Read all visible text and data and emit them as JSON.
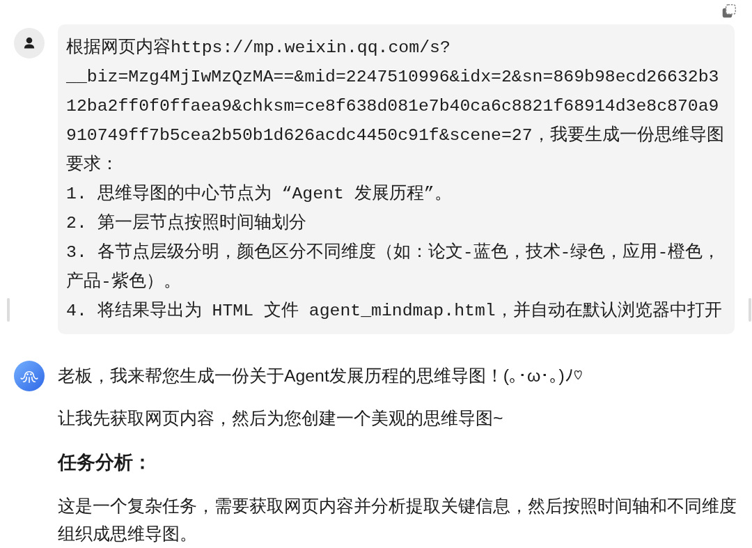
{
  "user_message": {
    "paragraphs": [
      "根据网页内容https://mp.weixin.qq.com/s?__biz=Mzg4MjIwMzQzMA==&mid=2247510996&idx=2&sn=869b98ecd26632b312ba2ff0f0ffaea9&chksm=ce8f638d081e7b40ca6c8821f68914d3e8c870a9910749ff7b5cea2b50b1d626acdc4450c91f&scene=27，我要生成一份思维导图",
      "要求：",
      "1. 思维导图的中心节点为 “Agent 发展历程”。",
      "2. 第一层节点按照时间轴划分",
      "3. 各节点层级分明，颜色区分不同维度（如：论文-蓝色，技术-绿色，应用-橙色，产品-紫色）。",
      "4. 将结果导出为 HTML 文件 agent_mindmap.html，并自动在默认浏览器中打开"
    ]
  },
  "assistant_message": {
    "blocks": [
      {
        "kind": "paragraph",
        "text": "老板，我来帮您生成一份关于Agent发展历程的思维导图！(｡･ω･｡)ﾉ♡"
      },
      {
        "kind": "paragraph",
        "text": "让我先获取网页内容，然后为您创建一个美观的思维导图~"
      },
      {
        "kind": "heading",
        "text": "任务分析："
      },
      {
        "kind": "paragraph",
        "text": "这是一个复杂任务，需要获取网页内容并分析提取关键信息，然后按照时间轴和不同维度组织成思维导图。"
      }
    ]
  }
}
